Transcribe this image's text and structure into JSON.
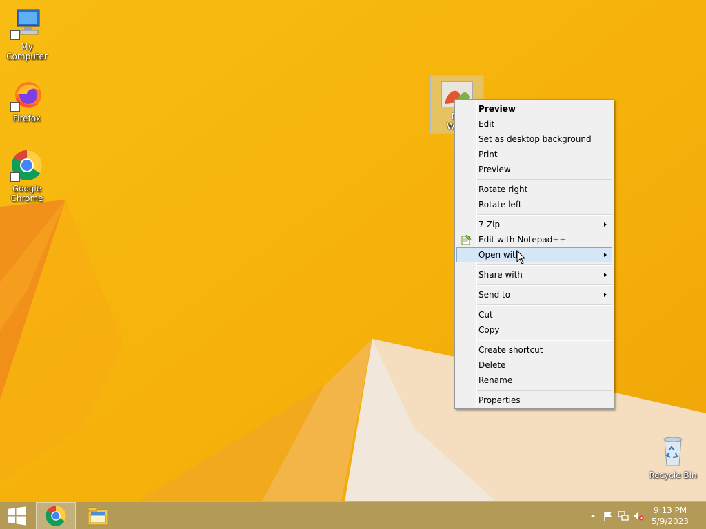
{
  "desktop": {
    "icons": [
      {
        "label": "My Computer",
        "icon": "computer-icon"
      },
      {
        "label": "Firefox",
        "icon": "firefox-icon"
      },
      {
        "label": "Google Chrome",
        "icon": "chrome-icon"
      },
      {
        "label": "Recycle Bin",
        "icon": "recycle-bin-icon"
      }
    ],
    "selected_file": {
      "label_line1": "No",
      "label_line2": "Wind",
      "icon": "image-file-icon"
    }
  },
  "context_menu": {
    "groups": [
      [
        {
          "label": "Preview",
          "bold": true
        },
        {
          "label": "Edit"
        },
        {
          "label": "Set as desktop background"
        },
        {
          "label": "Print"
        },
        {
          "label": "Preview"
        }
      ],
      [
        {
          "label": "Rotate right"
        },
        {
          "label": "Rotate left"
        }
      ],
      [
        {
          "label": "7-Zip",
          "submenu": true
        },
        {
          "label": "Edit with Notepad++",
          "icon": "notepad-plus-plus-icon"
        },
        {
          "label": "Open with",
          "submenu": true,
          "highlighted": true
        }
      ],
      [
        {
          "label": "Share with",
          "submenu": true
        }
      ],
      [
        {
          "label": "Send to",
          "submenu": true
        }
      ],
      [
        {
          "label": "Cut"
        },
        {
          "label": "Copy"
        }
      ],
      [
        {
          "label": "Create shortcut"
        },
        {
          "label": "Delete"
        },
        {
          "label": "Rename"
        }
      ],
      [
        {
          "label": "Properties"
        }
      ]
    ]
  },
  "taskbar": {
    "start_icon": "windows-logo-icon",
    "pinned": [
      {
        "name": "Google Chrome",
        "icon": "chrome-icon",
        "active": true
      },
      {
        "name": "File Explorer",
        "icon": "file-explorer-icon",
        "active": false
      }
    ],
    "tray": {
      "icons": [
        "show-hidden-icons-chevron-icon",
        "action-center-flag-icon",
        "network-icon",
        "volume-muted-icon"
      ],
      "time": "9:13 PM",
      "date": "5/9/2023"
    }
  },
  "colors": {
    "wallpaper": "#f5b30a",
    "menu_background": "#f0f0f0",
    "menu_highlight": "#d5e6f7",
    "menu_highlight_border": "#7aa8dd",
    "taskbar": "#b49a57"
  }
}
